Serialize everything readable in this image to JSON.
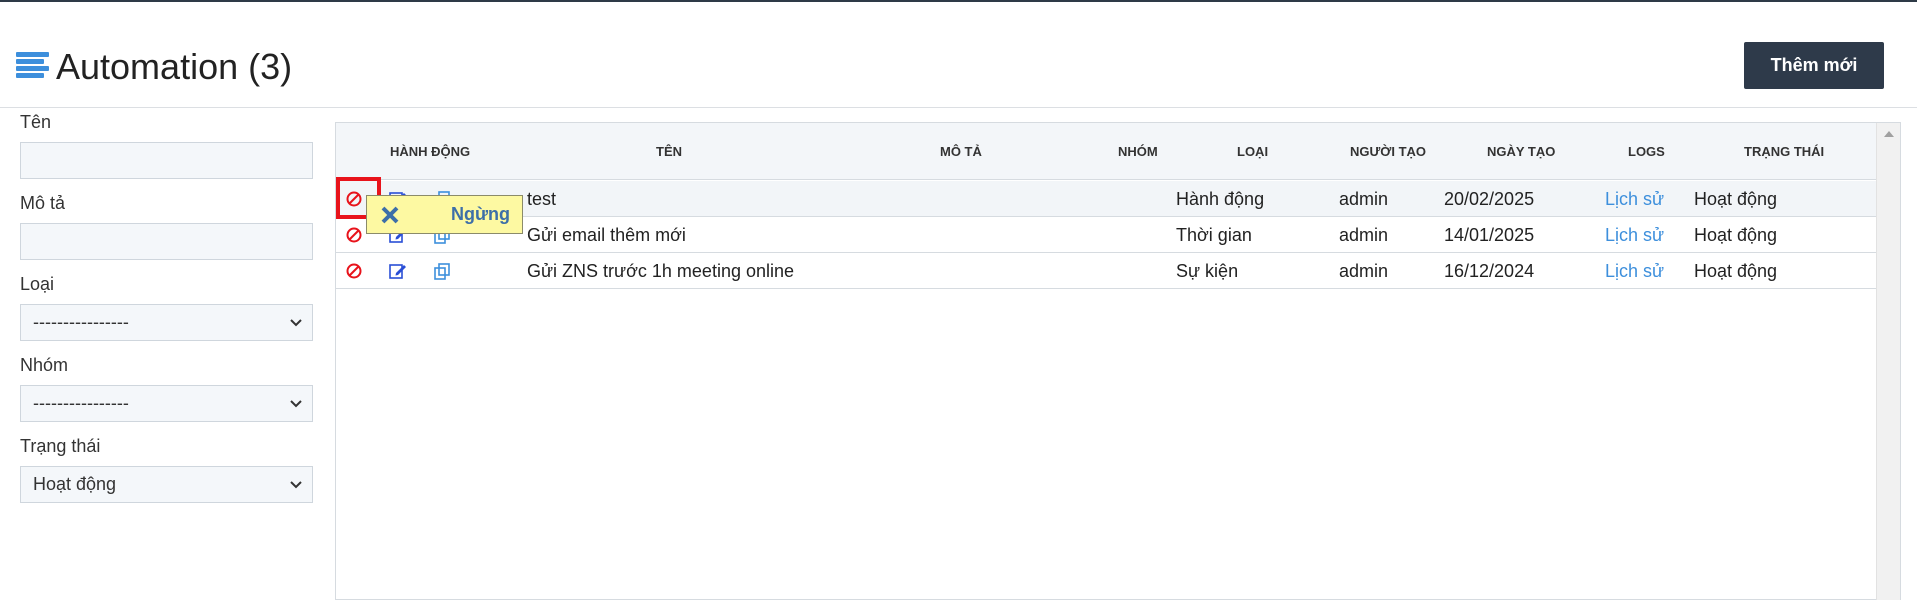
{
  "header": {
    "title": "Automation (3)",
    "add_button": "Thêm mới"
  },
  "filters": {
    "name_label": "Tên",
    "name_value": "",
    "description_label": "Mô tả",
    "description_value": "",
    "type_label": "Loại",
    "type_value": "----------------",
    "group_label": "Nhóm",
    "group_value": "----------------",
    "status_label": "Trạng thái",
    "status_value": "Hoạt động"
  },
  "table": {
    "columns": {
      "actions": "Hành động",
      "name": "Tên",
      "description": "Mô tả",
      "group": "Nhóm",
      "type": "Loại",
      "creator": "Người tạo",
      "created_date": "Ngày tạo",
      "logs": "Logs",
      "status": "Trạng thái"
    },
    "rows": [
      {
        "name": "test",
        "description": "",
        "group": "",
        "type": "Hành động",
        "creator": "admin",
        "created_date": "20/02/2025",
        "logs": "Lịch sử",
        "status": "Hoạt động"
      },
      {
        "name": "Gửi email thêm mới",
        "description": "",
        "group": "",
        "type": "Thời gian",
        "creator": "admin",
        "created_date": "14/01/2025",
        "logs": "Lịch sử",
        "status": "Hoạt động"
      },
      {
        "name": "Gửi ZNS trước 1h meeting online",
        "description": "",
        "group": "",
        "type": "Sự kiện",
        "creator": "admin",
        "created_date": "16/12/2024",
        "logs": "Lịch sử",
        "status": "Hoạt động"
      }
    ]
  },
  "tooltip": {
    "text": "Ngừng"
  },
  "colors": {
    "accent": "#3d8fdc",
    "button_dark": "#2e3a4a",
    "stop_icon": "#e8131b",
    "highlight": "#e8131b",
    "tooltip_bg": "#fdf9a2"
  },
  "icons": {
    "menu": "list-lines-icon",
    "stop": "ban-icon",
    "edit": "edit-icon",
    "copy": "copy-icon",
    "tooltip": "close-x-icon",
    "select": "chevron-down-icon"
  }
}
